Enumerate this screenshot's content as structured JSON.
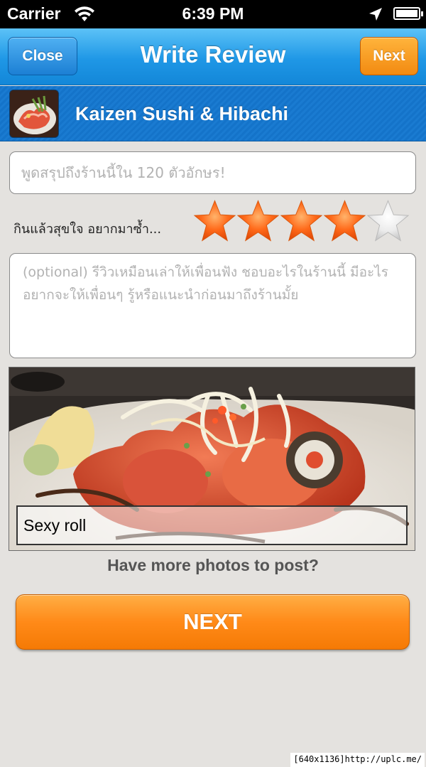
{
  "status_bar": {
    "carrier": "Carrier",
    "time": "6:39 PM",
    "icons": [
      "wifi-icon",
      "location-arrow-icon",
      "battery-icon"
    ]
  },
  "nav": {
    "title": "Write Review",
    "close_label": "Close",
    "next_label": "Next",
    "colors": {
      "bar": "#1f97e6",
      "next": "#f28a11"
    }
  },
  "restaurant": {
    "name": "Kaizen Sushi & Hibachi"
  },
  "summary": {
    "placeholder": "พูดสรุปถึงร้านนี้ใน 120 ตัวอักษร!",
    "value": ""
  },
  "rating": {
    "label": "กินแล้วสุขใจ อยากมาซ้ำ...",
    "value": 4,
    "max": 5,
    "filled_color": "#ff6a1a",
    "empty_color": "#e0e0e0"
  },
  "review": {
    "placeholder": "(optional) รีวิวเหมือนเล่าให้เพื่อนฟัง ชอบอะไรในร้านนี้ มีอะไรอยากจะให้เพื่อนๆ รู้หรือแนะนำก่อนมาถึงร้านมั้ย",
    "value": ""
  },
  "photo": {
    "caption": "Sexy roll"
  },
  "more_photos_text": "Have more photos to post?",
  "next_button_label": "NEXT",
  "watermark": "[640x1136]http://uplc.me/"
}
